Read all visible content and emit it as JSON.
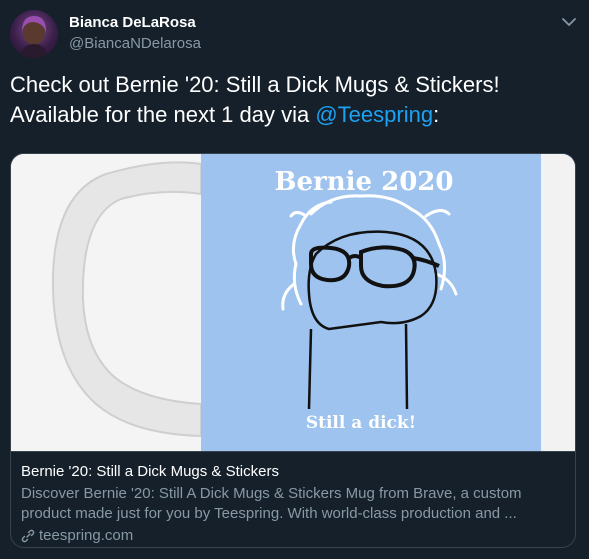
{
  "author": {
    "name": "Bianca DeLaRosa",
    "handle": "@BiancaNDelarosa"
  },
  "tweet": {
    "text_before": "Check out Bernie '20: Still a Dick Mugs & Stickers! Available for the next 1 day via ",
    "mention": "@Teespring",
    "text_after": ":"
  },
  "card": {
    "image": {
      "top_text": "Bernie 2020",
      "bottom_text": "Still a dick!"
    },
    "title": "Bernie '20: Still a Dick Mugs & Stickers",
    "description": "Discover Bernie '20: Still A Dick Mugs & Stickers Mug from Brave, a custom product made just for you by Teespring. With world-class production and ...",
    "domain": "teespring.com"
  },
  "icons": {
    "menu": "chevron-down-icon",
    "link": "link-icon"
  },
  "colors": {
    "background": "#15202b",
    "mention": "#1da1f2",
    "secondary_text": "#8899a6",
    "border": "#38444d",
    "mug_blue": "#9dc3ee"
  }
}
